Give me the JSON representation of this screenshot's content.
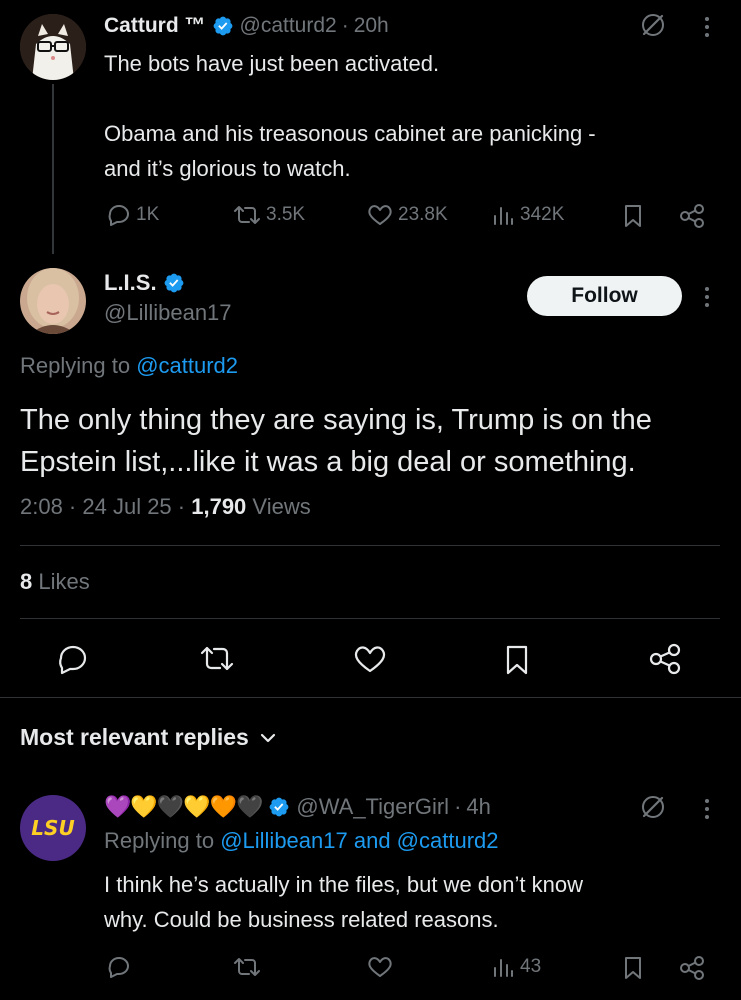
{
  "parent_tweet": {
    "display_name": "Catturd ™",
    "handle": "@catturd2",
    "time": "20h",
    "line1": "The bots have just been activated.",
    "line2": "Obama and his treasonous cabinet are panicking -",
    "line3": "and it’s glorious to watch.",
    "stats": {
      "replies": "1K",
      "reposts": "3.5K",
      "likes": "23.8K",
      "views": "342K"
    }
  },
  "main_tweet": {
    "display_name": "L.I.S.",
    "handle": "@Lillibean17",
    "follow_label": "Follow",
    "replying_prefix": "Replying to",
    "replying_to": "@catturd2",
    "line1": "The only thing they are saying is, Trump is on the",
    "line2": "Epstein list,...like it was a big deal or something.",
    "timestamp": "2:08 · 24 Jul 25 ·",
    "views_count": "1,790",
    "views_label": "Views",
    "likes_count": "8",
    "likes_label": "Likes"
  },
  "replies_header": {
    "label": "Most relevant replies"
  },
  "reply_tweet": {
    "display_name": "💜💛🖤💛🧡🖤",
    "handle": "@WA_TigerGirl",
    "time": "4h",
    "replying_prefix": "Replying to",
    "replying_to": "@Lillibean17 and @catturd2",
    "line1": "I think he’s actually in the files, but we don’t know",
    "line2": "why. Could be business related reasons.",
    "stats": {
      "views": "43"
    },
    "avatar_text": "LSU"
  },
  "colors": {
    "accent": "#1d9bf0",
    "muted": "#71767b",
    "text": "#e7e9ea",
    "divider": "#2f3336"
  },
  "icons": [
    "grok-icon",
    "more-icon",
    "reply-icon",
    "repost-icon",
    "like-icon",
    "views-icon",
    "bookmark-icon",
    "share-icon",
    "verified-icon",
    "chevron-down-icon"
  ]
}
